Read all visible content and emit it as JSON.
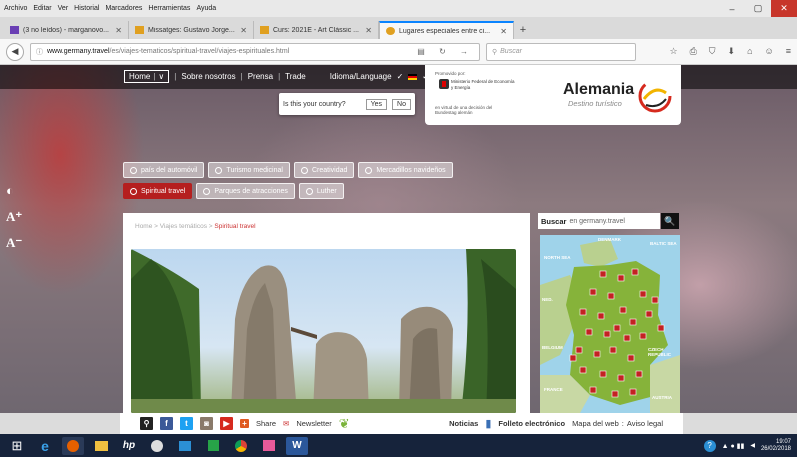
{
  "browser": {
    "menu": [
      "Archivo",
      "Editar",
      "Ver",
      "Historial",
      "Marcadores",
      "Herramientas",
      "Ayuda"
    ],
    "window_controls": [
      "–",
      "▢",
      "✕"
    ],
    "tabs": [
      {
        "label": "(3 no leídos) - marganovo...",
        "icon_color": "#6a3fb4",
        "active": false
      },
      {
        "label": "Missatges: Gustavo Jorge...",
        "icon_color": "#e0a020",
        "active": false
      },
      {
        "label": "Curs: 2021E - Art Clàssic ...",
        "icon_color": "#e0a020",
        "active": false
      },
      {
        "label": "Lugares especiales entre ci...",
        "icon_color": "#e0a020",
        "active": true
      }
    ],
    "new_tab": "+",
    "url_host": "www.germany.travel",
    "url_path": "/es/viajes-tematicos/spiritual-travel/viajes-espirituales.html",
    "search_placeholder": "Buscar",
    "toolbar_icons": [
      "☆",
      "⎙",
      "⛉",
      "⬇",
      "⌂",
      "☺",
      "≡"
    ]
  },
  "site": {
    "nav": {
      "home": "Home",
      "home_arrow": "∨",
      "about": "Sobre nosotros",
      "press": "Prensa",
      "trade": "Trade",
      "language": "Idioma/Language",
      "language_arrow": "✓"
    },
    "country_popup": {
      "question": "Is this your country?",
      "yes": "Yes",
      "no": "No"
    },
    "ministry": {
      "funded": "Promovido por:",
      "name": "Ministerio Federal de Economía y Energía",
      "footer": "en virtud de una decisión del Bundestag alemán"
    },
    "brand": {
      "name": "Alemania",
      "tagline": "Destino turístico"
    },
    "accessibility": [
      "◐",
      "A⁺",
      "A⁻"
    ],
    "chips": [
      {
        "label": "país del automóvil",
        "active": false
      },
      {
        "label": "Turismo medicinal",
        "active": false
      },
      {
        "label": "Creatividad",
        "active": false
      },
      {
        "label": "Mercadillos navideños",
        "active": false
      },
      {
        "label": "Spiritual travel",
        "active": true
      },
      {
        "label": "Parques de atracciones",
        "active": false
      },
      {
        "label": "Luther",
        "active": false
      }
    ],
    "breadcrumb": {
      "home": "Home",
      "sep": " > ",
      "section": "Viajes temáticos",
      "current": "Spiritual travel"
    },
    "search": {
      "label": "Buscar",
      "site": "en germany.travel",
      "button": "🔍"
    },
    "map_labels": [
      "DENMARK",
      "NORTH SEA",
      "BALTIC SEA",
      "NED.",
      "BELGIUM",
      "CZECH REPUBLIC",
      "FRANCE",
      "AUSTRIA"
    ]
  },
  "share_bar": {
    "share": "Share",
    "newsletter": "Newsletter",
    "news": "Noticias",
    "brochure": "Folleto electrónico",
    "sitemap": "Mapa del web",
    "legal": "Aviso legal"
  },
  "taskbar": {
    "time": "19:07",
    "date": "26/02/2018"
  }
}
